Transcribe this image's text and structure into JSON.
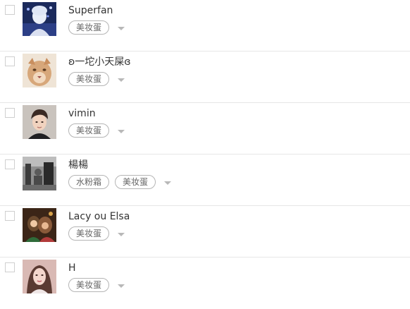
{
  "fans": [
    {
      "name": "Superfan",
      "tags": [
        "美妆蛋"
      ],
      "avatar_icon": "user-photo-concert"
    },
    {
      "name": "ʚ一坨小天屎ɞ",
      "tags": [
        "美妆蛋"
      ],
      "avatar_icon": "user-photo-lion"
    },
    {
      "name": "vimin",
      "tags": [
        "美妆蛋"
      ],
      "avatar_icon": "user-photo-portrait"
    },
    {
      "name": "楊楊",
      "tags": [
        "水粉霜",
        "美妆蛋"
      ],
      "avatar_icon": "user-photo-street"
    },
    {
      "name": "Lacy ou Elsa",
      "tags": [
        "美妆蛋"
      ],
      "avatar_icon": "user-photo-illustration"
    },
    {
      "name": "H",
      "tags": [
        "美妆蛋"
      ],
      "avatar_icon": "user-photo-woman"
    }
  ],
  "colors": {
    "divider": "#e6e6e6",
    "tag_border": "#b5b5b5",
    "caret": "#b8b8b8",
    "text": "#333333"
  }
}
